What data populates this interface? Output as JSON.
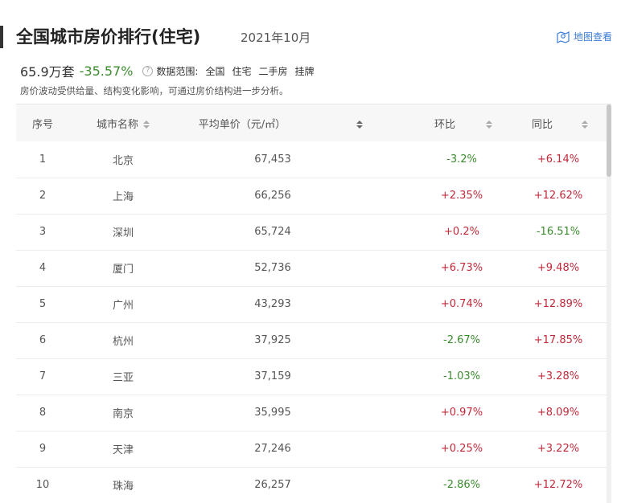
{
  "header": {
    "title": "全国城市房价排行(住宅)",
    "subtitle": "2021年10月",
    "map_link": "地图查看"
  },
  "summary": {
    "price": "65.9万套",
    "change_pct": "-35.57%",
    "help_icon_text": "?",
    "range_label": "数据范围:",
    "range_options": [
      "全国",
      "住宅",
      "二手房",
      "挂牌"
    ]
  },
  "note": "房价波动受供给量、结构变化影响，可通过房价结构进一步分析。",
  "table": {
    "columns": [
      "序号",
      "城市名称",
      "平均单价（元/㎡）",
      "环比",
      "同比"
    ],
    "rows": [
      {
        "rank": "1",
        "city": "北京",
        "price": "67,453",
        "mom": "-3.2%",
        "yoy": "+6.14%"
      },
      {
        "rank": "2",
        "city": "上海",
        "price": "66,256",
        "mom": "+2.35%",
        "yoy": "+12.62%"
      },
      {
        "rank": "3",
        "city": "深圳",
        "price": "65,724",
        "mom": "+0.2%",
        "yoy": "-16.51%"
      },
      {
        "rank": "4",
        "city": "厦门",
        "price": "52,736",
        "mom": "+6.73%",
        "yoy": "+9.48%"
      },
      {
        "rank": "5",
        "city": "广州",
        "price": "43,293",
        "mom": "+0.74%",
        "yoy": "+12.89%"
      },
      {
        "rank": "6",
        "city": "杭州",
        "price": "37,925",
        "mom": "-2.67%",
        "yoy": "+17.85%"
      },
      {
        "rank": "7",
        "city": "三亚",
        "price": "37,159",
        "mom": "-1.03%",
        "yoy": "+3.28%"
      },
      {
        "rank": "8",
        "city": "南京",
        "price": "35,995",
        "mom": "+0.97%",
        "yoy": "+8.09%"
      },
      {
        "rank": "9",
        "city": "天津",
        "price": "27,246",
        "mom": "+0.25%",
        "yoy": "+3.22%"
      },
      {
        "rank": "10",
        "city": "珠海",
        "price": "26,257",
        "mom": "-2.86%",
        "yoy": "+12.72%"
      }
    ]
  },
  "colors": {
    "increase": "#c0293a",
    "decrease": "#3b8c2e",
    "link": "#3a7bd5"
  }
}
